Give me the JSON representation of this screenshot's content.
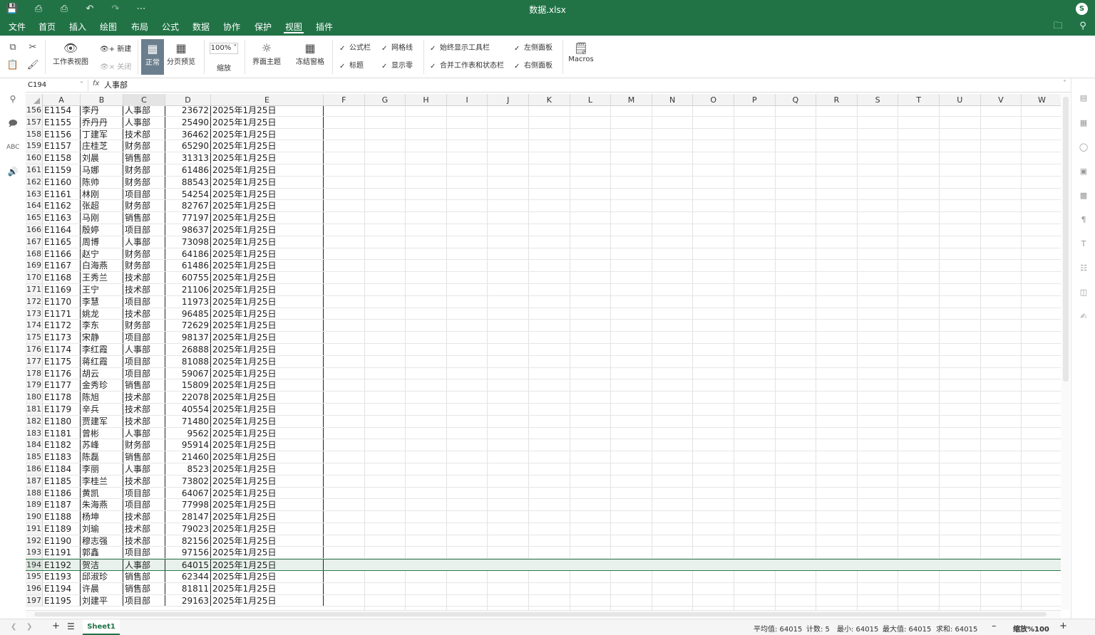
{
  "title": "数据.xlsx",
  "avatar": "S",
  "menu": [
    "文件",
    "首页",
    "插入",
    "绘图",
    "布局",
    "公式",
    "数据",
    "协作",
    "保护",
    "视图",
    "插件"
  ],
  "active_menu": "视图",
  "ribbon": {
    "sheet_view": "工作表视图",
    "new": "新建",
    "close": "关闭",
    "normal": "正常",
    "page_break": "分页预览",
    "zoom_value": "100%",
    "zoom": "缩放",
    "theme": "界面主题",
    "freeze": "冻结窗格",
    "formula_bar": "公式栏",
    "headings": "标题",
    "gridlines": "网格线",
    "zeros": "显示零",
    "always_toolbar": "始终显示工具栏",
    "combine": "合并工作表和状态栏",
    "left_panel": "左侧面板",
    "right_panel": "右侧面板",
    "macros": "Macros"
  },
  "namebox": "C194",
  "fx": "fx",
  "formula_value": "人事部",
  "columns": [
    "A",
    "B",
    "C",
    "D",
    "E",
    "F",
    "G",
    "H",
    "I",
    "J",
    "K",
    "L",
    "M",
    "N",
    "O",
    "P",
    "Q",
    "R",
    "S",
    "T",
    "U",
    "V",
    "W"
  ],
  "rows": [
    [
      "156",
      "E1154",
      "李丹",
      "人事部",
      "23672",
      "2025年1月25日"
    ],
    [
      "157",
      "E1155",
      "乔丹丹",
      "人事部",
      "25490",
      "2025年1月25日"
    ],
    [
      "158",
      "E1156",
      "丁建军",
      "技术部",
      "36462",
      "2025年1月25日"
    ],
    [
      "159",
      "E1157",
      "庄桂芝",
      "财务部",
      "65290",
      "2025年1月25日"
    ],
    [
      "160",
      "E1158",
      "刘晨",
      "销售部",
      "31313",
      "2025年1月25日"
    ],
    [
      "161",
      "E1159",
      "马娜",
      "财务部",
      "61486",
      "2025年1月25日"
    ],
    [
      "162",
      "E1160",
      "陈帅",
      "财务部",
      "88543",
      "2025年1月25日"
    ],
    [
      "163",
      "E1161",
      "林刚",
      "项目部",
      "54254",
      "2025年1月25日"
    ],
    [
      "164",
      "E1162",
      "张超",
      "财务部",
      "82767",
      "2025年1月25日"
    ],
    [
      "165",
      "E1163",
      "马刚",
      "销售部",
      "77197",
      "2025年1月25日"
    ],
    [
      "166",
      "E1164",
      "殷婷",
      "项目部",
      "98637",
      "2025年1月25日"
    ],
    [
      "167",
      "E1165",
      "周博",
      "人事部",
      "73098",
      "2025年1月25日"
    ],
    [
      "168",
      "E1166",
      "赵宁",
      "财务部",
      "64186",
      "2025年1月25日"
    ],
    [
      "169",
      "E1167",
      "白海燕",
      "财务部",
      "61486",
      "2025年1月25日"
    ],
    [
      "170",
      "E1168",
      "王秀兰",
      "技术部",
      "60755",
      "2025年1月25日"
    ],
    [
      "171",
      "E1169",
      "王宁",
      "技术部",
      "21106",
      "2025年1月25日"
    ],
    [
      "172",
      "E1170",
      "李慧",
      "项目部",
      "11973",
      "2025年1月25日"
    ],
    [
      "173",
      "E1171",
      "姚龙",
      "技术部",
      "96485",
      "2025年1月25日"
    ],
    [
      "174",
      "E1172",
      "李东",
      "财务部",
      "72629",
      "2025年1月25日"
    ],
    [
      "175",
      "E1173",
      "宋静",
      "项目部",
      "98137",
      "2025年1月25日"
    ],
    [
      "176",
      "E1174",
      "李红霞",
      "人事部",
      "26888",
      "2025年1月25日"
    ],
    [
      "177",
      "E1175",
      "蒋红霞",
      "项目部",
      "81088",
      "2025年1月25日"
    ],
    [
      "178",
      "E1176",
      "胡云",
      "项目部",
      "59067",
      "2025年1月25日"
    ],
    [
      "179",
      "E1177",
      "金秀珍",
      "销售部",
      "15809",
      "2025年1月25日"
    ],
    [
      "180",
      "E1178",
      "陈旭",
      "技术部",
      "22078",
      "2025年1月25日"
    ],
    [
      "181",
      "E1179",
      "辛兵",
      "技术部",
      "40554",
      "2025年1月25日"
    ],
    [
      "182",
      "E1180",
      "贾建军",
      "技术部",
      "71480",
      "2025年1月25日"
    ],
    [
      "183",
      "E1181",
      "曾彬",
      "人事部",
      "9562",
      "2025年1月25日"
    ],
    [
      "184",
      "E1182",
      "苏峰",
      "财务部",
      "95914",
      "2025年1月25日"
    ],
    [
      "185",
      "E1183",
      "陈磊",
      "销售部",
      "21460",
      "2025年1月25日"
    ],
    [
      "186",
      "E1184",
      "李丽",
      "人事部",
      "8523",
      "2025年1月25日"
    ],
    [
      "187",
      "E1185",
      "李桂兰",
      "技术部",
      "73802",
      "2025年1月25日"
    ],
    [
      "188",
      "E1186",
      "黄凯",
      "项目部",
      "64067",
      "2025年1月25日"
    ],
    [
      "189",
      "E1187",
      "朱海燕",
      "项目部",
      "77998",
      "2025年1月25日"
    ],
    [
      "190",
      "E1188",
      "杨坤",
      "技术部",
      "28147",
      "2025年1月25日"
    ],
    [
      "191",
      "E1189",
      "刘瑜",
      "技术部",
      "79023",
      "2025年1月25日"
    ],
    [
      "192",
      "E1190",
      "穆志强",
      "技术部",
      "82156",
      "2025年1月25日"
    ],
    [
      "193",
      "E1191",
      "郭鑫",
      "项目部",
      "97156",
      "2025年1月25日"
    ],
    [
      "194",
      "E1192",
      "贺洁",
      "人事部",
      "64015",
      "2025年1月25日"
    ],
    [
      "195",
      "E1193",
      "邱淑珍",
      "销售部",
      "62344",
      "2025年1月25日"
    ],
    [
      "196",
      "E1194",
      "许晨",
      "销售部",
      "81811",
      "2025年1月25日"
    ],
    [
      "197",
      "E1195",
      "刘建平",
      "项目部",
      "29163",
      "2025年1月25日"
    ]
  ],
  "selected_row": "194",
  "sheet": "Sheet1",
  "status": {
    "avg": "平均值: 64015",
    "count": "计数: 5",
    "min": "最小: 64015",
    "max": "最大值: 64015",
    "sum": "求和: 64015",
    "zoom": "缩放%100"
  }
}
